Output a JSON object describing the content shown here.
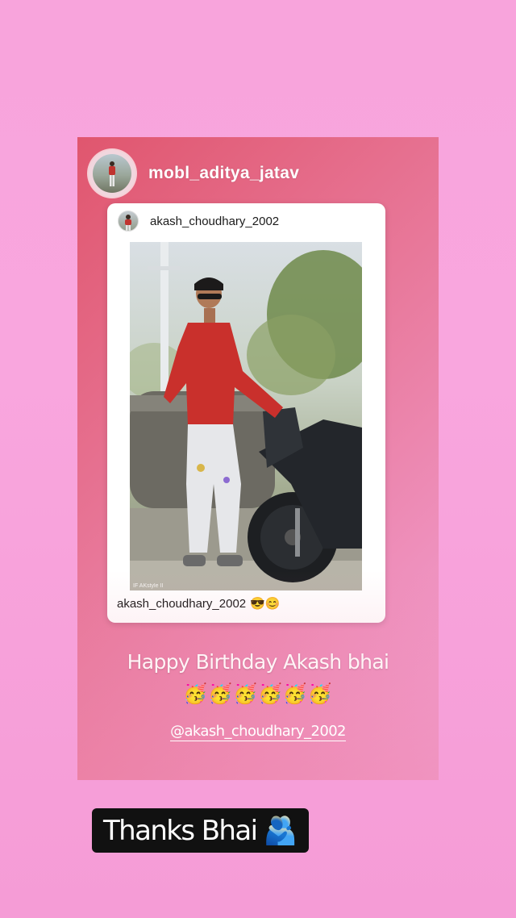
{
  "story": {
    "username": "mobl_aditya_jatav"
  },
  "post": {
    "username": "akash_choudhary_2002",
    "caption_username": "akash_choudhary_2002",
    "caption_emojis": "😎😊",
    "photo_watermark": "IF AKstyle II"
  },
  "overlay": {
    "birthday_text": "Happy Birthday Akash  bhai",
    "party_emojis": "🥳🥳🥳🥳🥳🥳",
    "mention": "@akash_choudhary_2002"
  },
  "reply": {
    "text": "Thanks Bhai",
    "emoji": "🫂"
  },
  "colors": {
    "background": "#f8a4dc",
    "card_gradient_start": "#e0566e",
    "card_gradient_end": "#f3a2d6",
    "reply_bg": "#111111"
  }
}
